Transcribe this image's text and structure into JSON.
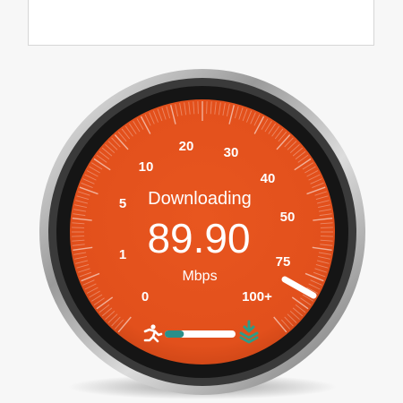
{
  "gauge": {
    "status": "Downloading",
    "speed": "89.90",
    "unit": "Mbps",
    "scale_labels": [
      "0",
      "1",
      "5",
      "10",
      "20",
      "30",
      "40",
      "50",
      "75",
      "100+"
    ],
    "progress_fraction": 0.27,
    "icons": {
      "left": "running-person-icon",
      "right": "download-layers-icon"
    },
    "colors": {
      "dial": "#e2501c",
      "dial_dark": "#c84315",
      "progress": "#2a8f8a",
      "track": "#ffffff",
      "download_icon": "#2e9c86"
    }
  }
}
